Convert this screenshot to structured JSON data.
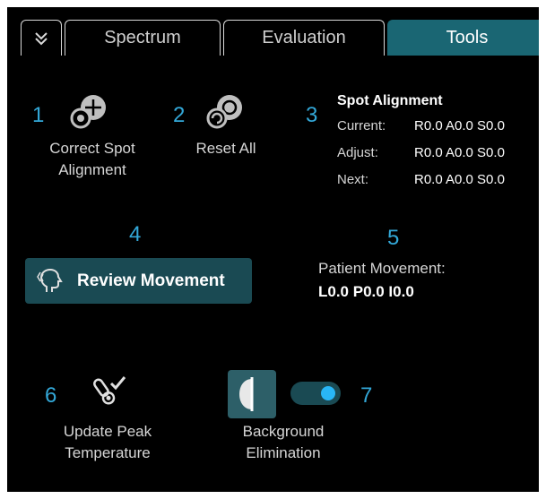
{
  "tabs": {
    "items": [
      {
        "label": "Spectrum"
      },
      {
        "label": "Evaluation"
      },
      {
        "label": "Tools",
        "active": true
      }
    ]
  },
  "tools": {
    "correct_spot": {
      "number": "1",
      "label_line1": "Correct Spot",
      "label_line2": "Alignment",
      "icon": "correct-spot-icon"
    },
    "reset_all": {
      "number": "2",
      "label": "Reset All",
      "icon": "reset-all-icon"
    },
    "spot_alignment": {
      "number": "3",
      "title": "Spot Alignment",
      "rows": [
        {
          "key": "Current:",
          "value": "R0.0 A0.0 S0.0"
        },
        {
          "key": "Adjust:",
          "value": "R0.0 A0.0 S0.0"
        },
        {
          "key": "Next:",
          "value": "R0.0 A0.0 S0.0"
        }
      ]
    },
    "review_movement": {
      "number": "4",
      "label": "Review Movement",
      "icon": "head-movement-icon"
    },
    "patient_movement": {
      "number": "5",
      "title": "Patient Movement:",
      "values": "L0.0 P0.0 I0.0"
    },
    "update_peak": {
      "number": "6",
      "label_line1": "Update Peak",
      "label_line2": "Temperature",
      "icon": "thermometer-check-icon"
    },
    "background_elimination": {
      "number": "7",
      "label_line1": "Background",
      "label_line2": "Elimination",
      "icon": "background-elimination-icon",
      "toggle_on": true
    }
  },
  "colors": {
    "accent": "#1a6673",
    "number": "#33a8d8",
    "toggle_knob": "#29b6f6"
  }
}
